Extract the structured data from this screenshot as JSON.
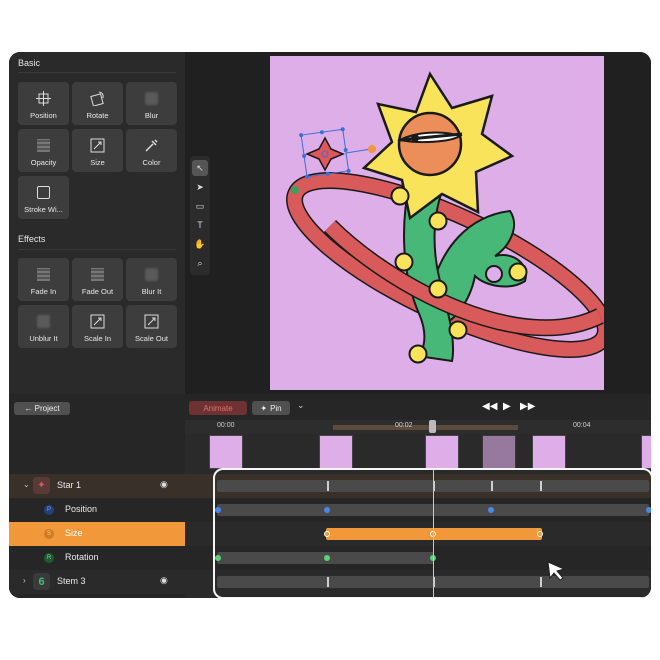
{
  "window_title": "",
  "left_panel": {
    "basic_title": "Basic",
    "effects_title": "Effects",
    "basic_items": [
      {
        "label": "Position",
        "icon": "move-icon"
      },
      {
        "label": "Rotate",
        "icon": "rotate-icon"
      },
      {
        "label": "Blur",
        "icon": "blur-icon"
      },
      {
        "label": "Opacity",
        "icon": "opacity-icon"
      },
      {
        "label": "Size",
        "icon": "resize-icon"
      },
      {
        "label": "Color",
        "icon": "eyedropper-icon"
      },
      {
        "label": "Stroke Wi...",
        "icon": "stroke-icon"
      }
    ],
    "effect_items": [
      {
        "label": "Fade In",
        "icon": "fade-in-icon"
      },
      {
        "label": "Fade Out",
        "icon": "fade-out-icon"
      },
      {
        "label": "Blur It",
        "icon": "blur-it-icon"
      },
      {
        "label": "Unblur It",
        "icon": "unblur-icon"
      },
      {
        "label": "Scale In",
        "icon": "scale-in-icon"
      },
      {
        "label": "Scale Out",
        "icon": "scale-out-icon"
      }
    ]
  },
  "toolbar": {
    "tools": [
      {
        "name": "select-tool",
        "glyph": "↖"
      },
      {
        "name": "direct-select-tool",
        "glyph": "➤"
      },
      {
        "name": "rectangle-tool",
        "glyph": "▭"
      },
      {
        "name": "text-tool",
        "glyph": "T"
      },
      {
        "name": "hand-tool",
        "glyph": "✋"
      },
      {
        "name": "zoom-tool",
        "glyph": "⌕"
      }
    ]
  },
  "timeline": {
    "project_button": "← Project",
    "animate_button": "Animate",
    "pin_button": "Pin",
    "ruler_labels": [
      "00:00",
      "00:02",
      "00:04"
    ],
    "layers": [
      {
        "label": "Star 1",
        "type": "group"
      },
      {
        "label": "Position",
        "type": "prop",
        "color": "#3a6fd8"
      },
      {
        "label": "Size",
        "type": "prop",
        "color": "#f0a03a"
      },
      {
        "label": "Rotation",
        "type": "prop",
        "color": "#3aa05a"
      },
      {
        "label": "Stem 3",
        "type": "group"
      }
    ]
  },
  "colors": {
    "accent": "#f0983a",
    "artboard": "#deaee8",
    "petals": "#f8e35a",
    "face": "#ec8e5a",
    "stem": "#48b878",
    "ring": "#d85a5a"
  }
}
